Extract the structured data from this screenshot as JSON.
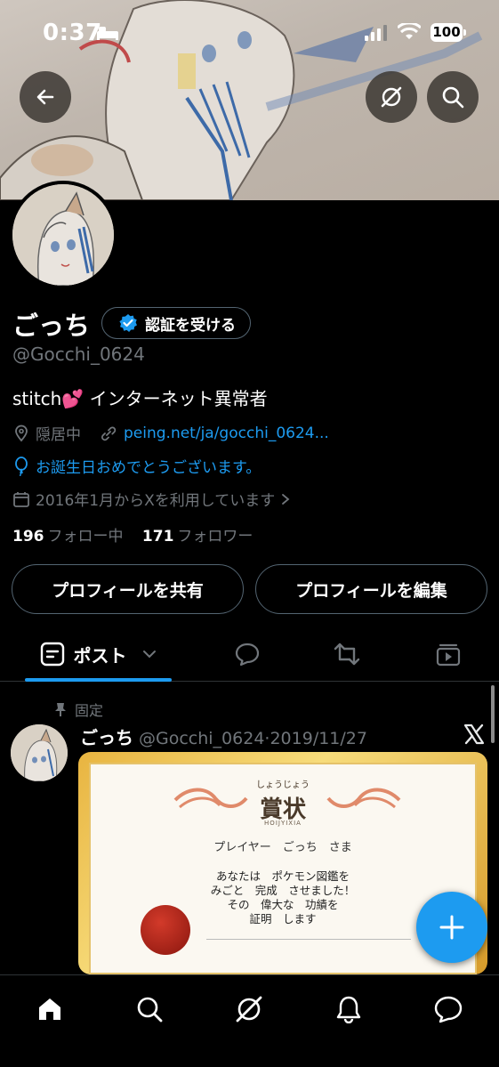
{
  "status_bar": {
    "time": "0:37",
    "battery": "100"
  },
  "profile": {
    "display_name": "ごっち",
    "verify_button": "認証を受ける",
    "handle": "@Gocchi_0624",
    "bio": "stitch💕 インターネット異常者",
    "location": "隠居中",
    "website": "peing.net/ja/gocchi_0624...",
    "birthday_text": "お誕生日おめでとうございます。",
    "joined": "2016年1月からXを利用しています",
    "following_count": "196",
    "following_label": "フォロー中",
    "followers_count": "171",
    "followers_label": "フォロワー"
  },
  "buttons": {
    "share_profile": "プロフィールを共有",
    "edit_profile": "プロフィールを編集"
  },
  "tabs": {
    "posts_label": "ポスト"
  },
  "pinned_post": {
    "pinned_label": "固定",
    "author_name": "ごっち",
    "author_handle": "@Gocchi_0624",
    "separator": "·",
    "date": "2019/11/27",
    "image": {
      "furigana": "しょうじょう",
      "title": "賞状",
      "subtitle": "HOIJYIXIA",
      "player_line": "プレイヤー　ごっち　さま",
      "body_line1": "あなたは　ポケモン図鑑を",
      "body_line2": "みごと　完成　させました！",
      "body_line3": "その　偉大な　功績を",
      "body_line4": "証明　します"
    }
  },
  "icons": {
    "back": "arrow-left-icon",
    "grok": "grok-icon",
    "search": "search-icon",
    "verified": "verified-badge-icon",
    "location": "location-pin-icon",
    "link": "link-icon",
    "balloon": "balloon-icon",
    "calendar": "calendar-icon",
    "chevron": "chevron-right-icon",
    "pin": "pin-icon",
    "x_logo": "x-logo-icon",
    "plus": "plus-icon"
  },
  "colors": {
    "accent": "#1d9bf0",
    "background": "#000000",
    "secondary_text": "#71767b",
    "border": "#536471"
  }
}
